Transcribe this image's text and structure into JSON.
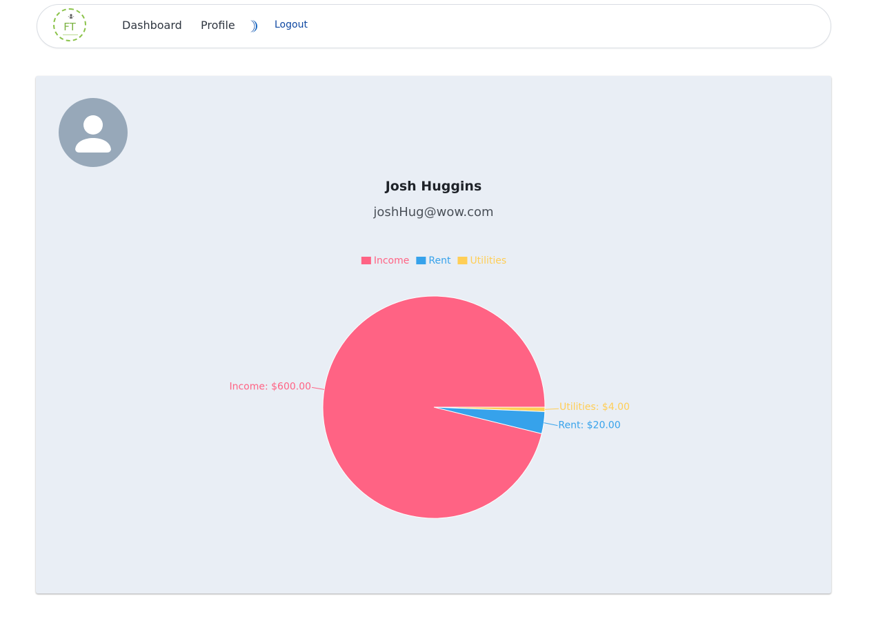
{
  "navbar": {
    "logo_text": "FT",
    "links": {
      "dashboard": "Dashboard",
      "profile": "Profile",
      "logout": "Logout"
    }
  },
  "profile": {
    "name": "Josh Huggins",
    "email": "joshHug@wow.com"
  },
  "chart_data": {
    "type": "pie",
    "legend_position": "top",
    "slices": [
      {
        "name": "Income",
        "value": 600,
        "label": "Income: $600.00",
        "color": "#ff6384"
      },
      {
        "name": "Rent",
        "value": 20,
        "label": "Rent: $20.00",
        "color": "#36a2eb"
      },
      {
        "name": "Utilities",
        "value": 4,
        "label": "Utilities: $4.00",
        "color": "#ffce56"
      }
    ]
  }
}
